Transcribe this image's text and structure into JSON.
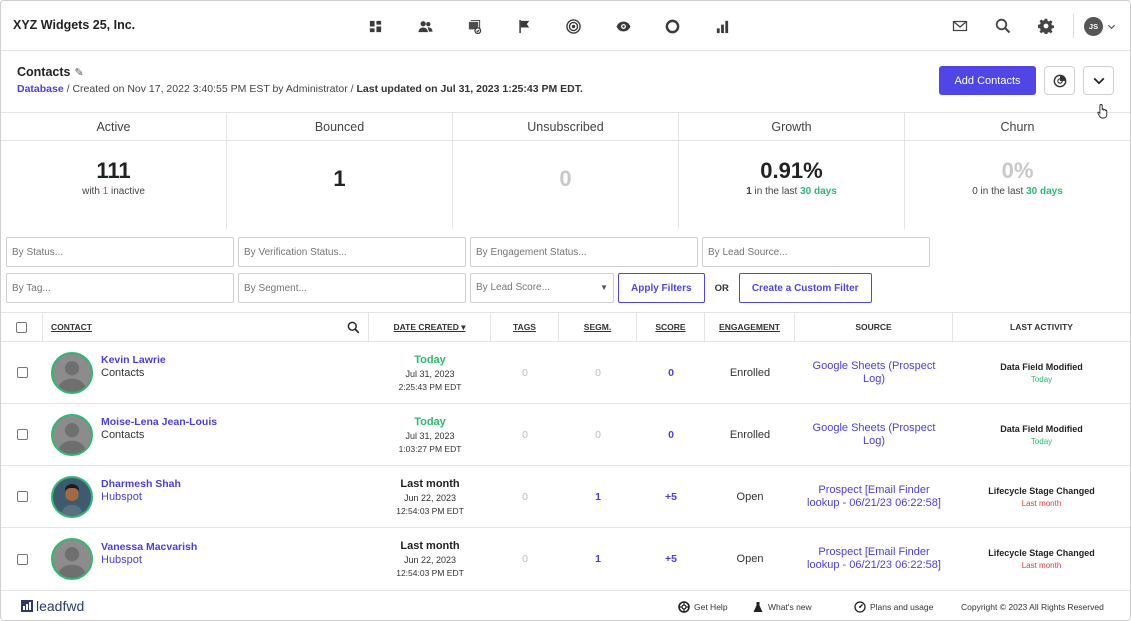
{
  "app": {
    "brand": "XYZ Widgets 25, Inc.",
    "user_initials": "JS"
  },
  "nav": {
    "icons": [
      "dashboard-icon",
      "people-icon",
      "database-icon",
      "flag-icon",
      "target-icon",
      "eye-icon",
      "circle-icon",
      "bar-chart-icon"
    ]
  },
  "header": {
    "title": "Contacts",
    "breadcrumb_link": "Database",
    "created_text": " / Created on Nov 17, 2022 3:40:55 PM EST by Administrator / ",
    "updated_text": "Last updated on Jul 31, 2023 1:25:43 PM EDT.",
    "add_button": "Add Contacts"
  },
  "stats": {
    "active": {
      "label": "Active",
      "value": "111",
      "sub_prefix": "with ",
      "sub_count": "1",
      "sub_suffix": " inactive"
    },
    "bounced": {
      "label": "Bounced",
      "value": "1"
    },
    "unsubscribed": {
      "label": "Unsubscribed",
      "value": "0"
    },
    "growth": {
      "label": "Growth",
      "value": "0.91%",
      "sub_prefix": "1",
      "sub_mid": " in the last ",
      "sub_period": "30 days"
    },
    "churn": {
      "label": "Churn",
      "value": "0%",
      "sub_prefix": "0",
      "sub_mid": " in the last ",
      "sub_period": "30 days"
    }
  },
  "filters": {
    "status": "By Status...",
    "verification": "By Verification Status...",
    "engagement": "By Engagement Status...",
    "lead_source": "By Lead Source...",
    "tag": "By Tag...",
    "segment": "By Segment...",
    "lead_score": "By Lead Score...",
    "apply": "Apply Filters",
    "or": "OR",
    "custom": "Create a Custom Filter"
  },
  "table": {
    "columns": {
      "contact": "CONTACT",
      "date": "DATE CREATED ▾",
      "tags": "TAGS",
      "segm": "SEGM.",
      "score": "SCORE",
      "engagement": "ENGAGEMENT",
      "source": "SOURCE",
      "activity": "LAST ACTIVITY"
    },
    "rows": [
      {
        "name": "Kevin Lawrie",
        "org": "Contacts",
        "date_rel": "Today",
        "date": "Jul 31, 2023",
        "time": "2:25:43 PM EDT",
        "tags": "0",
        "segm": "0",
        "score": "0",
        "engagement": "Enrolled",
        "source": "Google Sheets (Prospect Log)",
        "activity": "Data Field Modified",
        "activity_when": "Today"
      },
      {
        "name": "Moise-Lena Jean-Louis",
        "org": "Contacts",
        "date_rel": "Today",
        "date": "Jul 31, 2023",
        "time": "1:03:27 PM EDT",
        "tags": "0",
        "segm": "0",
        "score": "0",
        "engagement": "Enrolled",
        "source": "Google Sheets (Prospect Log)",
        "activity": "Data Field Modified",
        "activity_when": "Today"
      },
      {
        "name": "Dharmesh Shah",
        "org": "Hubspot",
        "date_rel": "Last month",
        "date": "Jun 22, 2023",
        "time": "12:54:03 PM EDT",
        "tags": "0",
        "segm": "1",
        "score": "+5",
        "engagement": "Open",
        "source": "Prospect [Email Finder lookup - 06/21/23 06:22:58]",
        "activity": "Lifecycle Stage Changed",
        "activity_when": "Last month"
      },
      {
        "name": "Vanessa Macvarish",
        "org": "Hubspot",
        "date_rel": "Last month",
        "date": "Jun 22, 2023",
        "time": "12:54:03 PM EDT",
        "tags": "0",
        "segm": "1",
        "score": "+5",
        "engagement": "Open",
        "source": "Prospect [Email Finder lookup - 06/21/23 06:22:58]",
        "activity": "Lifecycle Stage Changed",
        "activity_when": "Last month"
      }
    ]
  },
  "footer": {
    "logo": "leadfwd",
    "help": "Get Help",
    "whats_new": "What's new",
    "plans": "Plans and usage",
    "copyright": "Copyright © 2023 All Rights Reserved"
  },
  "colors": {
    "accent": "#4f46e5",
    "link": "#4a3ee0",
    "green": "#2eb872",
    "red": "#e04040"
  }
}
